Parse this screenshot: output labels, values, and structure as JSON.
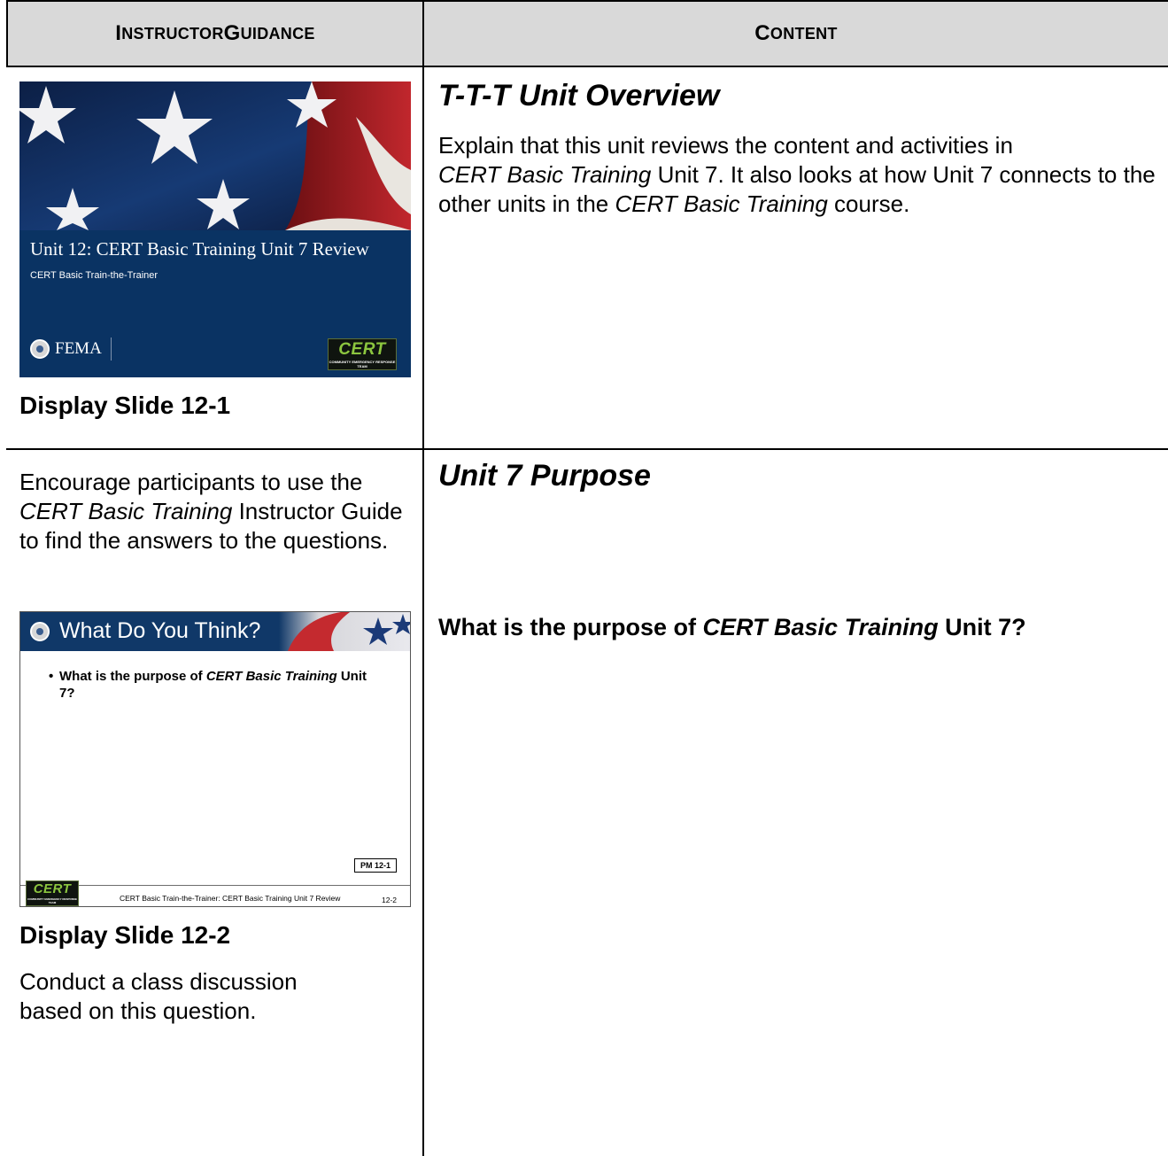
{
  "header": {
    "instructor_guidance_initial": "I",
    "instructor_guidance_rest": "NSTRUCTOR ",
    "instructor_guidance_initial2": "G",
    "instructor_guidance_rest2": "UIDANCE",
    "content_initial": "C",
    "content_rest": "ONTENT"
  },
  "row1": {
    "slide": {
      "title": "Unit 12: CERT Basic Training Unit 7 Review",
      "subtitle": "CERT Basic Train-the-Trainer",
      "agency": "FEMA",
      "logo_word": "CERT",
      "logo_tag": "COMMUNITY EMERGENCY RESPONSE TEAM"
    },
    "slide_label": "Display Slide 12-1",
    "topic": "T-T-T Unit Overview",
    "body_parts": [
      "Explain that this unit reviews the content and activities in",
      "CERT Basic Training",
      " Unit 7.  It also looks at how Unit 7 connects to the other units in the ",
      "CERT Basic Training",
      " course."
    ]
  },
  "row2": {
    "intro_parts": [
      "Encourage participants to use the ",
      "CERT Basic Training",
      " Instructor Guide to find the answers to the questions."
    ],
    "slide": {
      "title": "What Do You Think?",
      "bullet_parts": [
        "What is the purpose of ",
        "CERT Basic Training",
        " Unit 7?"
      ],
      "pm_label": "PM 12-1",
      "footer": "CERT Basic Train-the-Trainer: CERT Basic Training Unit 7 Review",
      "slide_number": "12-2",
      "logo_word": "CERT",
      "logo_tag": "COMMUNITY EMERGENCY RESPONSE TEAM"
    },
    "slide_label": "Display Slide 12-2",
    "after_text": "Conduct a class discussion based on this question.",
    "topic": "Unit 7 Purpose",
    "question_parts": [
      "What is the purpose of ",
      "CERT Basic Training",
      " Unit 7?"
    ]
  }
}
